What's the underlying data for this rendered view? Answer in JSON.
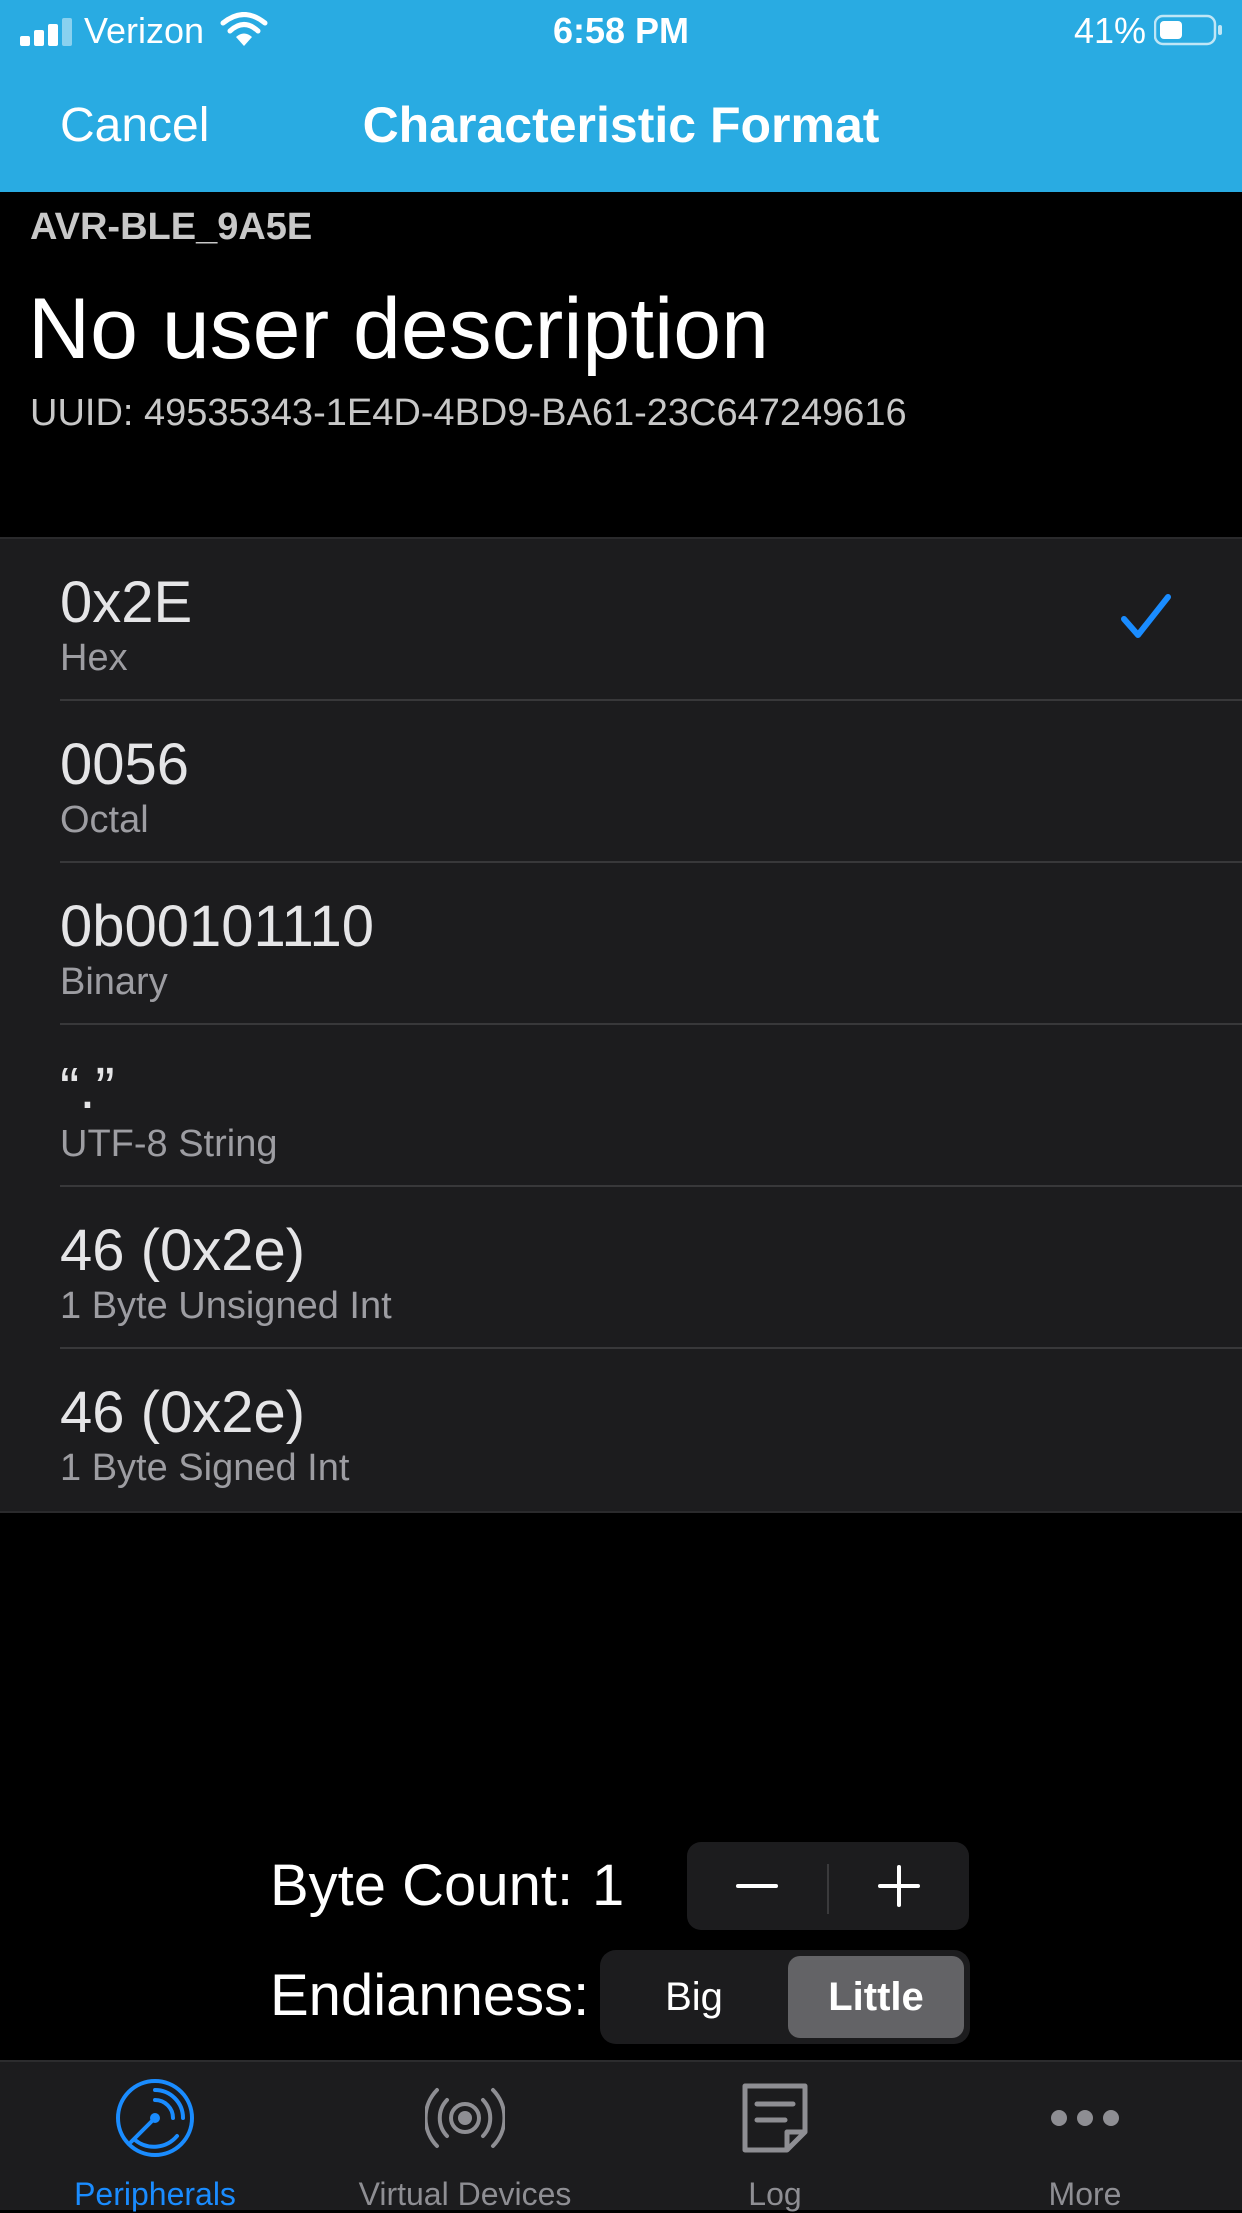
{
  "status_bar": {
    "carrier": "Verizon",
    "time": "6:58 PM",
    "battery_percent": "41%"
  },
  "nav": {
    "cancel_label": "Cancel",
    "title": "Characteristic Format"
  },
  "header": {
    "device_name": "AVR-BLE_9A5E",
    "user_description": "No user description",
    "uuid": "UUID: 49535343-1E4D-4BD9-BA61-23C647249616"
  },
  "formats": [
    {
      "value": "0x2E",
      "label": "Hex",
      "selected": true
    },
    {
      "value": "0056",
      "label": "Octal",
      "selected": false
    },
    {
      "value": "0b00101110",
      "label": "Binary",
      "selected": false
    },
    {
      "value": "“.”",
      "label": "UTF-8 String",
      "selected": false
    },
    {
      "value": "46 (0x2e)",
      "label": "1 Byte Unsigned Int",
      "selected": false
    },
    {
      "value": "46 (0x2e)",
      "label": "1 Byte Signed Int",
      "selected": false
    }
  ],
  "controls": {
    "byte_count_label": "Byte Count:",
    "byte_count_value": "1",
    "endianness_label": "Endianness:",
    "endianness_options": [
      "Big",
      "Little"
    ],
    "endianness_selected": "Little"
  },
  "tabbar": {
    "tabs": [
      {
        "label": "Peripherals",
        "icon": "radar-icon",
        "active": true
      },
      {
        "label": "Virtual Devices",
        "icon": "broadcast-icon",
        "active": false
      },
      {
        "label": "Log",
        "icon": "log-icon",
        "active": false
      },
      {
        "label": "More",
        "icon": "more-icon",
        "active": false
      }
    ]
  },
  "colors": {
    "nav_bar": "#29abe2",
    "accent": "#1a8cff"
  }
}
